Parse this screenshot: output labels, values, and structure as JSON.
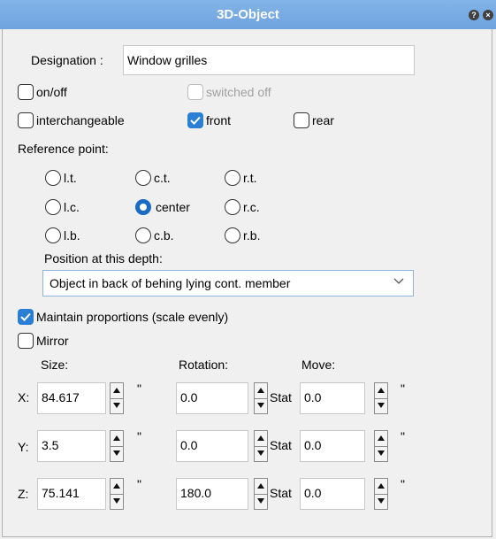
{
  "window": {
    "title": "3D-Object"
  },
  "designation": {
    "label": "Designation :",
    "value": "Window grilles"
  },
  "options": {
    "on_off": {
      "label": "on/off",
      "checked": false
    },
    "switched_off": {
      "label": "switched off",
      "checked": false,
      "disabled": true
    },
    "interchangeable": {
      "label": "interchangeable",
      "checked": false
    },
    "front": {
      "label": "front",
      "checked": true
    },
    "rear": {
      "label": "rear",
      "checked": false
    }
  },
  "reference_point": {
    "label": "Reference point:",
    "options": [
      "l.t.",
      "c.t.",
      "r.t.",
      "l.c.",
      "center",
      "r.c.",
      "l.b.",
      "c.b.",
      "r.b."
    ],
    "selected": "center"
  },
  "position_depth": {
    "label": "Position at this depth:",
    "selected": "Object in back of behing lying cont. member"
  },
  "maintain_proportions": {
    "label": "Maintain proportions (scale evenly)",
    "checked": true
  },
  "mirror": {
    "label": "Mirror",
    "checked": false
  },
  "columns": {
    "size": "Size:",
    "rotation": "Rotation:",
    "move": "Move:"
  },
  "rows": [
    {
      "axis": "X:",
      "size": "84.617",
      "size_unit": "\"",
      "rotation": "0.0",
      "rot_label": "Stat",
      "move": "0.0",
      "move_unit": "\""
    },
    {
      "axis": "Y:",
      "size": "3.5",
      "size_unit": "\"",
      "rotation": "0.0",
      "rot_label": "Stat",
      "move": "0.0",
      "move_unit": "\""
    },
    {
      "axis": "Z:",
      "size": "75.141",
      "size_unit": "\"",
      "rotation": "180.0",
      "rot_label": "Stat",
      "move": "0.0",
      "move_unit": "\""
    }
  ],
  "colors": {
    "title_bar": "#6fa3dd",
    "check_accent": "#2a7fd4",
    "radio_accent": "#1a6bc4"
  },
  "icons": {
    "help": "question-icon",
    "close": "close-icon"
  }
}
